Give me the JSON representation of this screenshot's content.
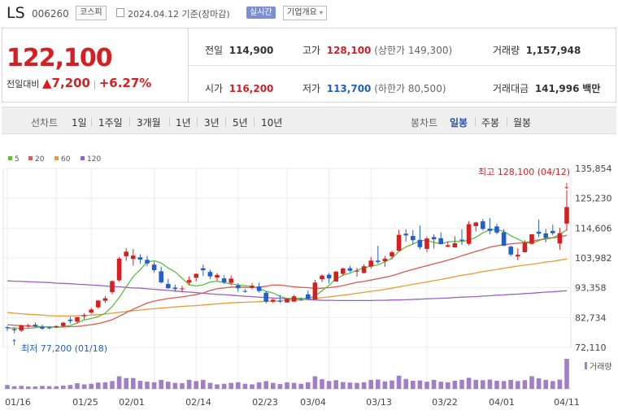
{
  "header": {
    "name": "LS",
    "code": "006260",
    "market": "코스피",
    "date": "2024.04.12 기준(장마감)",
    "realtime": "실시간",
    "company_info": "기업개요"
  },
  "quote": {
    "price": "122,100",
    "change_label": "전일대비",
    "change_arrow": "▲",
    "change": "7,200",
    "change_pct": "+6.27%",
    "prev_label": "전일",
    "prev": "114,900",
    "high_label": "고가",
    "high": "128,100",
    "upper_limit": "(상한가 149,300)",
    "volume_label": "거래량",
    "volume": "1,157,948",
    "open_label": "시가",
    "open": "116,200",
    "low_label": "저가",
    "low": "113,700",
    "lower_limit": "(하한가 80,500)",
    "amount_label": "거래대금",
    "amount": "141,996",
    "amount_unit": "백만"
  },
  "tabs": {
    "line_label": "선차트",
    "line": [
      "1일",
      "1주일",
      "3개월",
      "1년",
      "3년",
      "5년",
      "10년"
    ],
    "candle_label": "봉차트",
    "candle": [
      "일봉",
      "주봉",
      "월봉"
    ],
    "candle_selected": "일봉"
  },
  "colors": {
    "up": "#d71f21",
    "down": "#1f5fcf",
    "ma5": "#5cbf3f",
    "ma20": "#e0584f",
    "ma60": "#e89b32",
    "ma120": "#9a61c2",
    "volume": "#a27ec9"
  },
  "chart_data": {
    "type": "candlestick",
    "legend": [
      "5",
      "20",
      "60",
      "120"
    ],
    "y_ticks": [
      "135,854",
      "125,230",
      "114,606",
      "103,982",
      "93,358",
      "82,734",
      "72,110"
    ],
    "ylim": [
      72110,
      135854
    ],
    "x_ticks": [
      "01/16",
      "01/25",
      "02/01",
      "02/14",
      "02/23",
      "03/04",
      "03/13",
      "03/22",
      "04/01",
      "04/11"
    ],
    "max_annotation": "최고 128,100 (04/12)",
    "min_annotation": "최저 77,200 (01/18)",
    "volume_label": "거래량",
    "candles": [
      [
        79300,
        79700,
        78000,
        79000
      ],
      [
        78600,
        79300,
        77200,
        78200
      ],
      [
        78100,
        80200,
        77600,
        79900
      ],
      [
        79700,
        80500,
        79000,
        80000
      ],
      [
        80200,
        81000,
        79200,
        79600
      ],
      [
        79400,
        80200,
        78400,
        78800
      ],
      [
        79200,
        79600,
        78600,
        78900
      ],
      [
        79300,
        80000,
        79000,
        79700
      ],
      [
        79700,
        81200,
        79200,
        80900
      ],
      [
        82000,
        83000,
        80600,
        81500
      ],
      [
        81300,
        83000,
        80600,
        82900
      ],
      [
        83200,
        84300,
        82000,
        83600
      ],
      [
        84500,
        86200,
        84000,
        85600
      ],
      [
        86400,
        89000,
        85900,
        88800
      ],
      [
        88700,
        90400,
        87900,
        89600
      ],
      [
        91800,
        96000,
        91000,
        95700
      ],
      [
        96000,
        104300,
        95600,
        103700
      ],
      [
        104600,
        107500,
        102900,
        106200
      ],
      [
        103600,
        107100,
        101200,
        104800
      ],
      [
        104200,
        105300,
        102000,
        103400
      ],
      [
        103300,
        104700,
        101100,
        102000
      ],
      [
        101600,
        102700,
        98800,
        99600
      ],
      [
        99200,
        100900,
        94900,
        95300
      ],
      [
        94700,
        96500,
        93000,
        93200
      ],
      [
        93400,
        94500,
        92000,
        92900
      ],
      [
        93000,
        94100,
        91700,
        93100
      ],
      [
        95200,
        97500,
        94300,
        96100
      ],
      [
        96900,
        98500,
        95600,
        98300
      ],
      [
        100300,
        101600,
        97600,
        99600
      ],
      [
        99000,
        99800,
        96500,
        97400
      ],
      [
        97000,
        98600,
        95800,
        97900
      ],
      [
        96700,
        97800,
        94700,
        95300
      ],
      [
        95100,
        97700,
        94300,
        96600
      ],
      [
        94200,
        95000,
        91900,
        93200
      ],
      [
        92200,
        92900,
        91600,
        91900
      ],
      [
        93400,
        95000,
        92800,
        94100
      ],
      [
        93800,
        95200,
        91600,
        92200
      ],
      [
        91600,
        92100,
        87800,
        88400
      ],
      [
        88400,
        89400,
        87900,
        89100
      ],
      [
        88700,
        90800,
        87900,
        88400
      ],
      [
        88100,
        89500,
        88200,
        89600
      ],
      [
        88400,
        90800,
        89000,
        90300
      ],
      [
        89100,
        89900,
        88800,
        89000
      ],
      [
        91000,
        92300,
        89000,
        89400
      ],
      [
        89200,
        96200,
        89000,
        95200
      ],
      [
        96400,
        98100,
        95400,
        97700
      ],
      [
        98000,
        98600,
        94900,
        96700
      ],
      [
        95600,
        99300,
        95500,
        99100
      ],
      [
        98300,
        100600,
        97600,
        100200
      ],
      [
        100300,
        101200,
        98900,
        99400
      ],
      [
        99400,
        100400,
        97300,
        99400
      ],
      [
        98600,
        101700,
        98400,
        101000
      ],
      [
        100900,
        104300,
        100200,
        103000
      ],
      [
        103000,
        108300,
        101900,
        102500
      ],
      [
        102800,
        104600,
        100800,
        103700
      ],
      [
        104500,
        106600,
        103500,
        106000
      ],
      [
        106500,
        114000,
        106400,
        112200
      ],
      [
        112600,
        114200,
        109800,
        112000
      ],
      [
        111800,
        113900,
        108800,
        110300
      ],
      [
        110400,
        115500,
        107000,
        107800
      ],
      [
        107200,
        111600,
        106100,
        110900
      ],
      [
        111400,
        112400,
        107300,
        110600
      ],
      [
        111000,
        113100,
        108800,
        108900
      ],
      [
        108000,
        109800,
        107700,
        108500
      ],
      [
        107700,
        111700,
        107900,
        109200
      ],
      [
        110500,
        114200,
        108600,
        110100
      ],
      [
        109000,
        117100,
        108500,
        116000
      ],
      [
        115300,
        116800,
        113400,
        116600
      ],
      [
        117000,
        117900,
        113700,
        114300
      ],
      [
        114400,
        118200,
        112400,
        113600
      ],
      [
        115200,
        116200,
        112300,
        113000
      ],
      [
        113100,
        114200,
        108200,
        108300
      ],
      [
        108000,
        108300,
        104600,
        105200
      ],
      [
        104500,
        107400,
        103200,
        105100
      ],
      [
        106000,
        110300,
        106000,
        109400
      ],
      [
        109000,
        112500,
        108700,
        112400
      ],
      [
        113300,
        117700,
        111400,
        112600
      ],
      [
        112700,
        114300,
        109500,
        111200
      ],
      [
        113600,
        115800,
        112000,
        112800
      ],
      [
        109100,
        114700,
        106900,
        112800
      ],
      [
        116200,
        128100,
        113700,
        122100
      ]
    ],
    "ma5": [
      79000,
      79000,
      78900,
      78900,
      79100,
      79400,
      79400,
      79300,
      79500,
      79900,
      80800,
      81900,
      82400,
      83100,
      84300,
      86700,
      89900,
      93700,
      97300,
      99800,
      102500,
      103000,
      102200,
      100400,
      99000,
      96700,
      94400,
      94000,
      94400,
      95400,
      95700,
      95200,
      94700,
      94400,
      94100,
      93800,
      93000,
      92100,
      91500,
      90300,
      89500,
      89600,
      89600,
      89500,
      90400,
      92300,
      94200,
      96500,
      97800,
      98600,
      99600,
      100400,
      101100,
      101500,
      102600,
      103900,
      106300,
      107900,
      108900,
      110100,
      110200,
      109500,
      109000,
      109700,
      109900,
      109800,
      110300,
      111300,
      112900,
      114000,
      114100,
      113400,
      111900,
      110700,
      109400,
      109200,
      110100,
      111200,
      111200,
      112300,
      114000
    ],
    "ma20": [
      80200,
      80000,
      79900,
      79700,
      79600,
      79500,
      79400,
      79300,
      79400,
      79500,
      79600,
      79900,
      80200,
      80600,
      81200,
      82000,
      83200,
      84500,
      85700,
      86800,
      87900,
      88600,
      89100,
      89500,
      89800,
      90100,
      90500,
      90900,
      91500,
      92400,
      93000,
      93300,
      93600,
      93600,
      93500,
      93400,
      93600,
      93900,
      94300,
      94300,
      94000,
      93700,
      93500,
      93400,
      93100,
      93200,
      93400,
      93700,
      94100,
      94700,
      95300,
      95600,
      96100,
      96600,
      97100,
      97600,
      98400,
      99200,
      99900,
      100600,
      101200,
      101900,
      102500,
      103200,
      103900,
      104800,
      105500,
      106300,
      107000,
      107800,
      108300,
      108700,
      109000,
      109200,
      109500,
      109900,
      110400,
      110700,
      111100,
      111500,
      112000
    ],
    "ma60": [
      84500,
      84300,
      84100,
      83900,
      83800,
      83600,
      83400,
      83300,
      83300,
      83300,
      83400,
      83500,
      83600,
      83800,
      84000,
      84300,
      84600,
      84900,
      85200,
      85400,
      85700,
      85900,
      86100,
      86300,
      86500,
      86700,
      86900,
      87000,
      87200,
      87400,
      87600,
      87800,
      88000,
      88100,
      88200,
      88300,
      88400,
      88500,
      88600,
      88700,
      88800,
      88900,
      89100,
      89300,
      89500,
      89800,
      90100,
      90400,
      90700,
      91000,
      91400,
      91700,
      92100,
      92400,
      92800,
      93200,
      93700,
      94100,
      94600,
      95000,
      95400,
      95900,
      96300,
      96800,
      97300,
      97800,
      98200,
      98600,
      99100,
      99500,
      99900,
      100300,
      100700,
      101100,
      101400,
      101700,
      102100,
      102500,
      102800,
      103200,
      103600
    ],
    "ma120": [
      95800,
      95700,
      95600,
      95500,
      95400,
      95300,
      95200,
      95000,
      94900,
      94800,
      94600,
      94500,
      94300,
      94200,
      94000,
      93800,
      93700,
      93500,
      93300,
      93200,
      93000,
      92800,
      92600,
      92400,
      92200,
      92000,
      91800,
      91600,
      91400,
      91200,
      91000,
      90900,
      90700,
      90500,
      90300,
      90200,
      90000,
      89900,
      89700,
      89600,
      89400,
      89300,
      89200,
      89100,
      89000,
      88900,
      88900,
      88800,
      88800,
      88800,
      88800,
      88800,
      88800,
      88900,
      88900,
      89000,
      89000,
      89100,
      89200,
      89300,
      89400,
      89500,
      89600,
      89700,
      89900,
      90000,
      90100,
      90200,
      90400,
      90500,
      90700,
      90800,
      91000,
      91100,
      91300,
      91400,
      91600,
      91800,
      91900,
      92100,
      92300
    ],
    "volume": [
      0.13,
      0.09,
      0.1,
      0.08,
      0.08,
      0.1,
      0.09,
      0.09,
      0.11,
      0.13,
      0.19,
      0.15,
      0.17,
      0.21,
      0.22,
      0.26,
      0.42,
      0.36,
      0.36,
      0.27,
      0.24,
      0.22,
      0.3,
      0.24,
      0.2,
      0.19,
      0.3,
      0.26,
      0.3,
      0.2,
      0.15,
      0.17,
      0.2,
      0.22,
      0.17,
      0.15,
      0.22,
      0.26,
      0.2,
      0.16,
      0.22,
      0.2,
      0.17,
      0.22,
      0.42,
      0.32,
      0.26,
      0.29,
      0.23,
      0.21,
      0.2,
      0.22,
      0.3,
      0.31,
      0.25,
      0.28,
      0.44,
      0.33,
      0.27,
      0.28,
      0.24,
      0.3,
      0.24,
      0.22,
      0.27,
      0.3,
      0.37,
      0.3,
      0.29,
      0.31,
      0.27,
      0.26,
      0.3,
      0.26,
      0.29,
      0.42,
      0.35,
      0.3,
      0.26,
      0.31,
      1.0
    ]
  }
}
